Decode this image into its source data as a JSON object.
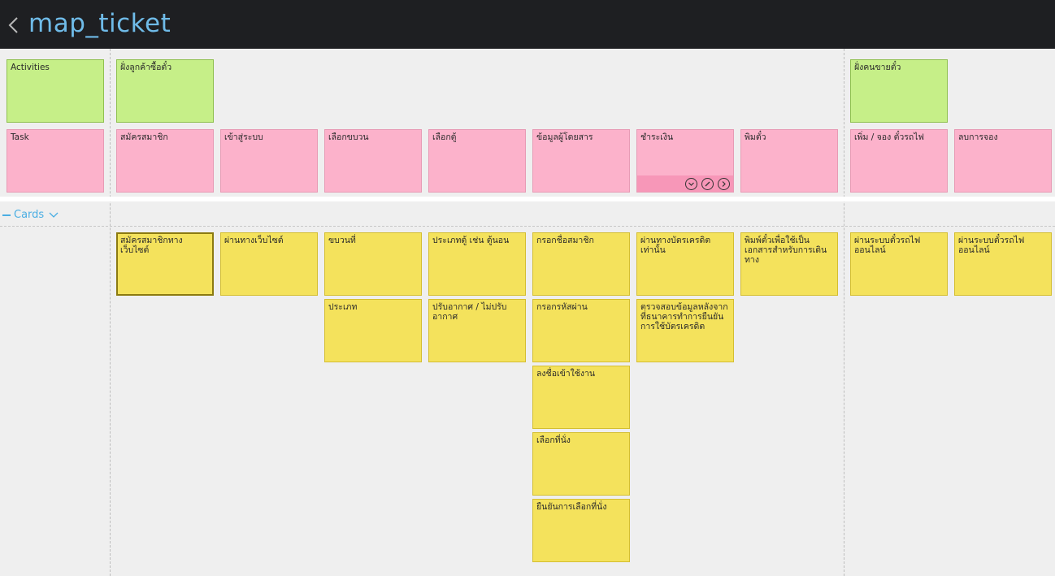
{
  "header": {
    "title": "map_ticket"
  },
  "activities": [
    {
      "label": "Activities"
    },
    {
      "label": "ฝั่งลูกค้าซื้อตั๋ว"
    },
    {
      "label": "ฝั่งคนขายตั๋ว"
    }
  ],
  "tasks": [
    {
      "label": "Task"
    },
    {
      "label": "สมัครสมาชิก"
    },
    {
      "label": "เข้าสู่ระบบ"
    },
    {
      "label": "เลือกขบวน"
    },
    {
      "label": "เลือกตู้"
    },
    {
      "label": "ข้อมูลผู้โดยสาร"
    },
    {
      "label": "ชำระเงิน"
    },
    {
      "label": "พิมตั๋ว"
    },
    {
      "label": "เพิ่ม / จอง ตั๋วรถไฟ"
    },
    {
      "label": "ลบการจอง"
    }
  ],
  "cards_section": {
    "label": "Cards"
  },
  "cards": [
    {
      "label": "สมัครสมาชิกทางเว็บไซต์"
    },
    {
      "label": "ผ่านทางเว็บไซต์"
    },
    {
      "label": "ขบวนที่"
    },
    {
      "label": "ประเภทตู้ เช่น ตู้นอน"
    },
    {
      "label": "กรอกชื่อสมาชิก"
    },
    {
      "label": "ผ่านทางบัตรเครดิตเท่านั้น"
    },
    {
      "label": "พิมพ์ตั๋วเพื่อใช้เป็นเอกสารสำหรับการเดินทาง"
    },
    {
      "label": "ผ่านระบบตั๋วรถไฟออนไลน์"
    },
    {
      "label": "ผ่านระบบตั๋วรถไฟออนไลน์"
    },
    {
      "label": "ประเภท"
    },
    {
      "label": "ปรับอากาศ / ไม่ปรับอากาศ"
    },
    {
      "label": "กรอกรหัสผ่าน"
    },
    {
      "label": "ตรวจสอบข้อมูลหลังจากที่ธนาคารทำการยืนยันการใช้บัตรเครดิต"
    },
    {
      "label": "ลงชื่อเข้าใช้งาน"
    },
    {
      "label": "เลือกที่นั่ง"
    },
    {
      "label": "ยืนยันการเลือกที่นั่ง"
    }
  ],
  "icons": {
    "back": "chevron-left-icon",
    "cards_collapse": "minus-icon",
    "cards_expand": "chevron-down-icon",
    "card_toolbar": [
      "chevron-down-circle-icon",
      "edit-circle-icon",
      "chevron-right-circle-icon"
    ]
  },
  "colors": {
    "topbar": "#1e1f22",
    "title": "#6fbbe8",
    "activity": "#c6ef88",
    "task": "#fcb2cb",
    "card": "#f4e25c",
    "accent": "#4aaee3"
  }
}
